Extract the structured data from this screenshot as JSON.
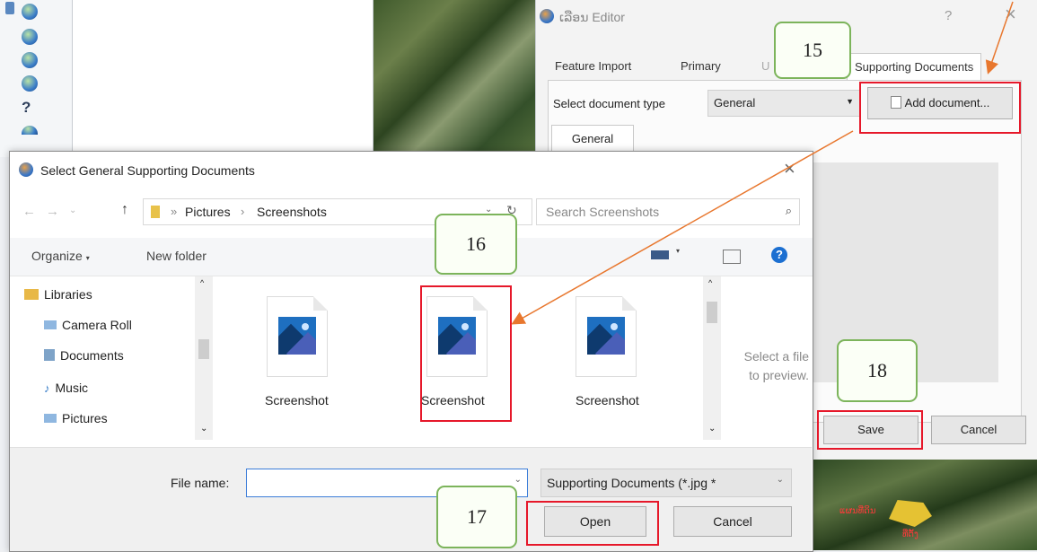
{
  "editor": {
    "title": "Editor",
    "title_prefix": "ເລືອນ",
    "help": "?",
    "close": "×",
    "tabs": [
      "Feature Import",
      "Primary",
      "U",
      "Supporting Documents"
    ],
    "doc_type_label": "Select document type",
    "doc_type_value": "General",
    "add_document_label": "Add document...",
    "subtab": "General",
    "save_label": "Save",
    "cancel_label": "Cancel"
  },
  "dialog": {
    "title": "Select General Supporting Documents",
    "close": "×",
    "breadcrumb": [
      "Pictures",
      "Screenshots"
    ],
    "search_placeholder": "Search Screenshots",
    "organize_label": "Organize",
    "new_folder_label": "New folder",
    "nav_items": [
      {
        "label": "Libraries",
        "icon": "library-icon"
      },
      {
        "label": "Camera Roll",
        "icon": "pictures-folder-icon"
      },
      {
        "label": "Documents",
        "icon": "documents-folder-icon"
      },
      {
        "label": "Music",
        "icon": "music-folder-icon"
      },
      {
        "label": "Pictures",
        "icon": "pictures-folder-icon"
      }
    ],
    "files": [
      {
        "label": "Screenshot"
      },
      {
        "label": "Screenshot"
      },
      {
        "label": "Screenshot"
      }
    ],
    "preview_text_1": "Select a file",
    "preview_text_2": "to preview.",
    "file_name_label": "File name:",
    "file_name_value": "",
    "file_type_value": "Supporting Documents (*.jpg *",
    "open_label": "Open",
    "cancel_label": "Cancel"
  },
  "callouts": [
    "15",
    "16",
    "17",
    "18"
  ],
  "map": {
    "label_1": "ແຜນທີ່ດິນ",
    "label_2": "ທີ່ຕັ້ງ"
  },
  "colors": {
    "callout_border": "#7cb45b",
    "highlight": "#e6182a",
    "arrow": "#e8772e"
  }
}
